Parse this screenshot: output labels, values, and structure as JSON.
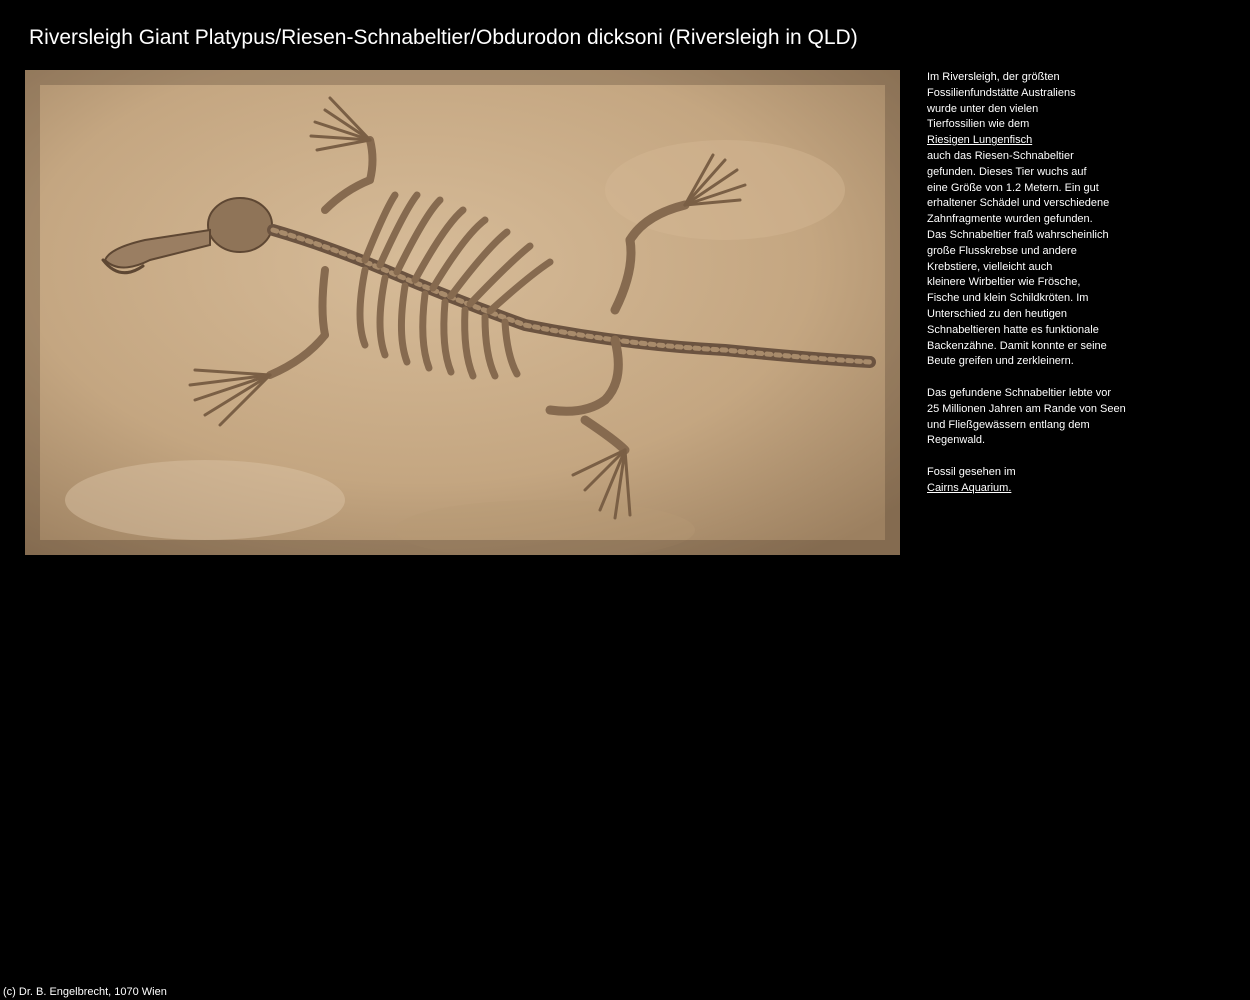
{
  "page": {
    "title": "Riversleigh Giant Platypus/Riesen-Schnabeltier/Obdurodon dicksoni (Riversleigh in QLD)"
  },
  "photo": {
    "subject": "fossil-skeleton-photo",
    "colors": {
      "background": "#c9ad89",
      "bone": "#8a6f53",
      "shadow": "#5e4733"
    }
  },
  "description": {
    "p1_lines": [
      "Im Riversleigh, der größten",
      "Fossilienfundstätte Australiens",
      "wurde unter den vielen",
      "Tierfossilien wie dem"
    ],
    "link_lungenfisch": "Riesigen Lungenfisch",
    "p1_lines_after": [
      "auch das Riesen-Schnabeltier",
      "gefunden. Dieses Tier wuchs auf",
      "eine Größe von 1.2 Metern. Ein gut",
      "erhaltener Schädel und verschiedene",
      "Zahnfragmente wurden gefunden.",
      "Das Schnabeltier fraß wahrscheinlich",
      "große Flusskrebse und andere",
      "Krebstiere, vielleicht auch",
      "kleinere Wirbeltier wie Frösche,",
      "Fische und klein Schildkröten. Im",
      "Unterschied zu den heutigen",
      "Schnabeltieren hatte es funktionale",
      "Backenzähne. Damit konnte er seine",
      "Beute greifen und zerkleinern."
    ],
    "p2_lines": [
      "Das gefundene Schnabeltier lebte vor",
      "25 Millionen Jahren am Rande von Seen",
      "und Fließgewässern entlang dem",
      "Regenwald."
    ],
    "p3_line": "Fossil gesehen im",
    "link_aquarium": "Cairns Aquarium."
  },
  "footer": {
    "copyright": "(c) Dr. B. Engelbrecht, 1070 Wien"
  }
}
